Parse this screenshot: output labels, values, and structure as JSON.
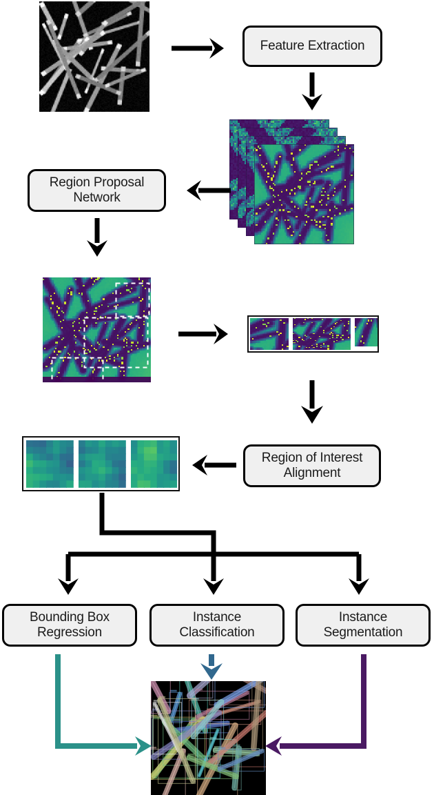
{
  "diagram": {
    "title": "Mask R-CNN nanowire instance segmentation pipeline",
    "type": "flowchart"
  },
  "boxes": [
    {
      "id": "feature_extraction",
      "label": "Feature Extraction"
    },
    {
      "id": "region_proposal_network",
      "label": "Region Proposal\nNetwork"
    },
    {
      "id": "roi_alignment",
      "label": "Region of Interest\nAlignment"
    },
    {
      "id": "bounding_box_regression",
      "label": "Bounding Box\nRegression"
    },
    {
      "id": "instance_classification",
      "label": "Instance\nClassification"
    },
    {
      "id": "instance_segmentation",
      "label": "Instance\nSegmentation"
    }
  ],
  "box_labels": {
    "feature_extraction": "Feature Extraction",
    "region_proposal_network_line1": "Region Proposal",
    "region_proposal_network_line2": "Network",
    "roi_alignment_line1": "Region of Interest",
    "roi_alignment_line2": "Alignment",
    "bounding_box_regression_line1": "Bounding Box",
    "bounding_box_regression_line2": "Regression",
    "instance_classification_line1": "Instance",
    "instance_classification_line2": "Classification",
    "instance_segmentation_line1": "Instance",
    "instance_segmentation_line2": "Segmentation"
  },
  "images": [
    {
      "id": "input_micrograph",
      "kind": "grayscale-sem-nanowires"
    },
    {
      "id": "feature_map_stack",
      "kind": "viridis-feature-maps",
      "count": 4
    },
    {
      "id": "proposal_map",
      "kind": "viridis-feature-map-with-proposals",
      "proposal_boxes": 3
    },
    {
      "id": "roi_crops",
      "kind": "viridis-roi-crops",
      "count": 3
    },
    {
      "id": "aligned_rois",
      "kind": "viridis-coarse-heatmaps",
      "count": 3,
      "grid": "7x7"
    },
    {
      "id": "final_result",
      "kind": "instance-segmentation-overlay"
    }
  ],
  "colors": {
    "box_fill": "#f0f0f0",
    "box_border": "#000000",
    "arrow_black": "#000000",
    "arrow_bbox_regression": "#2b9189",
    "arrow_classification": "#31688e",
    "arrow_segmentation": "#4a1a63",
    "viridis_dark": "#440154",
    "viridis_green": "#52c076",
    "viridis_yellow": "#e8e01f"
  },
  "connectors": [
    {
      "id": "input-to-feature-extraction",
      "direction": "right",
      "color": "#000000"
    },
    {
      "id": "feature-extraction-to-stack",
      "direction": "down",
      "color": "#000000"
    },
    {
      "id": "stack-to-rpn",
      "direction": "left",
      "color": "#000000"
    },
    {
      "id": "rpn-to-proposal-map",
      "direction": "down",
      "color": "#000000"
    },
    {
      "id": "proposal-map-to-roi-crops",
      "direction": "right",
      "color": "#000000"
    },
    {
      "id": "roi-crops-to-roi-alignment",
      "direction": "down",
      "color": "#000000"
    },
    {
      "id": "roi-alignment-to-aligned-rois",
      "direction": "left",
      "color": "#000000"
    },
    {
      "id": "aligned-rois-to-heads",
      "direction": "down-split-three",
      "color": "#000000"
    },
    {
      "id": "bbox-regression-to-result",
      "direction": "down-then-right",
      "color": "#2b9189"
    },
    {
      "id": "classification-to-result",
      "direction": "down",
      "color": "#31688e"
    },
    {
      "id": "segmentation-to-result",
      "direction": "down-then-left",
      "color": "#4a1a63"
    }
  ]
}
